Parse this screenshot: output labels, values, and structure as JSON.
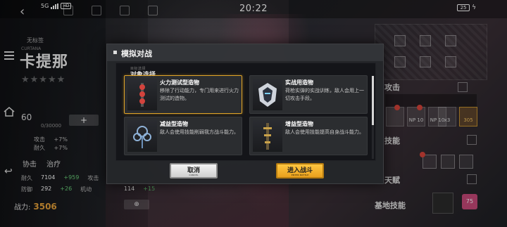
{
  "status_bar": {
    "network": "5G",
    "hd": "HD",
    "time": "20:22",
    "battery": "25"
  },
  "character": {
    "subtitle": "无标签",
    "name_en": "CURTANA",
    "name": "卡提那",
    "stars": "★★★★★",
    "level": "60",
    "exp": "0/30000",
    "plus": "+",
    "bonus": [
      {
        "label": "攻击",
        "pct": "+7%"
      },
      {
        "label": "耐久",
        "pct": "+7%"
      }
    ],
    "roles": [
      "协击",
      "治疗"
    ],
    "stats": [
      {
        "label": "耐久",
        "value": "7104",
        "add": "+959",
        "label2": "攻击"
      },
      {
        "label": "防御",
        "value": "292",
        "add": "+26",
        "label2": "机动"
      },
      {
        "label": "",
        "value": "114",
        "add": "+15",
        "label2": ""
      }
    ],
    "power_label": "战力:",
    "power_value": "3506"
  },
  "right_panel": {
    "attack_label": "攻击",
    "skills_label": "技能",
    "talent_label": "天赋",
    "base_skill_label": "基地技能",
    "np_chips": [
      "NP 10",
      "NP 10",
      "x3",
      "305"
    ],
    "pink_badge": "75"
  },
  "modal": {
    "title": "模拟对战",
    "section_sub": "目标选择",
    "section_title": "对象选择",
    "cards": [
      {
        "name": "火力测试型造物",
        "desc": "移除了行动能力，专门用来进行火力测试的造物。",
        "selected": true
      },
      {
        "name": "实战用造物",
        "desc": "荷枪实弹的实战训练，敌人会用上一切攻击手段。",
        "selected": false
      },
      {
        "name": "减益型造物",
        "desc": "敌人会使用技能削弱我方战斗能力。",
        "selected": false
      },
      {
        "name": "增益型造物",
        "desc": "敌人会使用技能提高自身战斗能力。",
        "selected": false
      }
    ],
    "cancel_label": "取消",
    "cancel_sub": "CANCEL",
    "enter_label": "进入战斗",
    "enter_sub": "ENTER BATTLE"
  },
  "colors": {
    "accent": "#e0a428",
    "power": "#e8a33a",
    "bonus_green": "#6ad07a"
  }
}
